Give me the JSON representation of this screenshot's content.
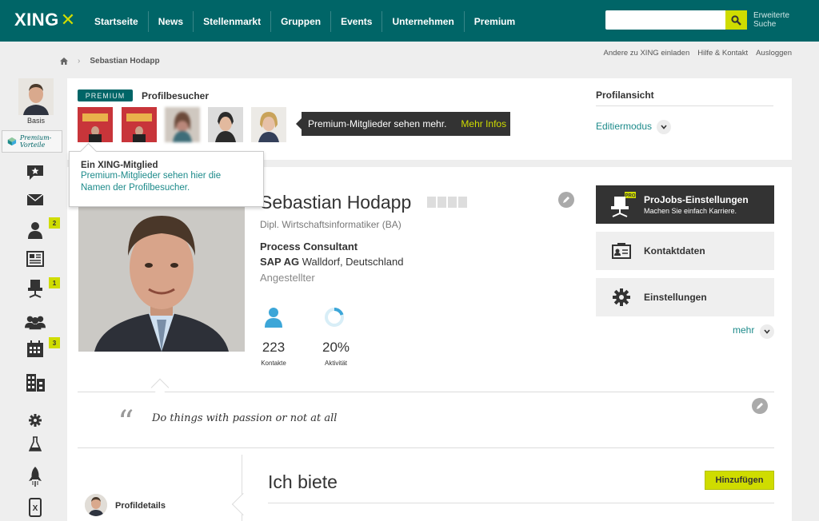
{
  "header": {
    "logo": "XING",
    "nav": [
      "Startseite",
      "News",
      "Stellenmarkt",
      "Gruppen",
      "Events",
      "Unternehmen",
      "Premium"
    ],
    "search_placeholder": "",
    "advanced_search": "Erweiterte Suche",
    "accent": "#cfdc00",
    "brand": "#006567"
  },
  "util_links": [
    "Andere zu XING einladen",
    "Hilfe & Kontakt",
    "Ausloggen"
  ],
  "breadcrumb": {
    "current": "Sebastian Hodapp"
  },
  "sidebar": {
    "membership": "Basis",
    "premium_benefits": "Premium-Vorteile",
    "badges": {
      "contacts": "2",
      "jobs": "1",
      "events": "3"
    }
  },
  "visitors": {
    "premium_badge": "PREMIUM",
    "title": "Profilbesucher",
    "tooltip_text": "Premium-Mitglieder sehen mehr.",
    "tooltip_link": "Mehr Infos",
    "member_tip_title": "Ein XING-Mitglied",
    "member_tip_body": "Premium-Mitglieder sehen hier die Namen der Profilbesucher."
  },
  "profile_view": {
    "title": "Profilansicht",
    "edit_mode": "Editiermodus"
  },
  "profile": {
    "name": "Sebastian Hodapp",
    "degree": "Dipl. Wirtschaftsinformatiker (BA)",
    "position": "Process Consultant",
    "company": "SAP AG",
    "location": "Walldorf, Deutschland",
    "status": "Angestellter",
    "contacts_count": "223",
    "contacts_label": "Kontakte",
    "activity": "20%",
    "activity_fraction": 0.2,
    "activity_label": "Aktivität",
    "quote": "Do things with passion or not at all"
  },
  "actions": {
    "projobs_title": "ProJobs-Einstellungen",
    "projobs_sub": "Machen Sie einfach Karriere.",
    "projobs_badge": "PRO",
    "contact_data": "Kontaktdaten",
    "settings": "Einstellungen",
    "more": "mehr"
  },
  "sections": {
    "offer_title": "Ich biete",
    "add_button": "Hinzufügen",
    "profile_details": "Profildetails"
  }
}
